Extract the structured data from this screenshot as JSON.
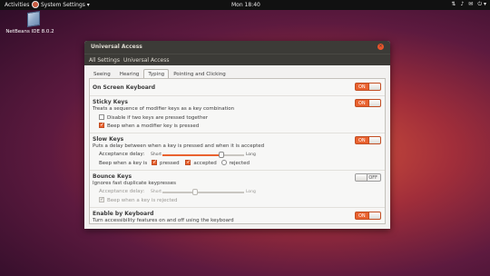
{
  "topbar": {
    "activities": "Activities",
    "app_menu": "System Settings ▾",
    "clock": "Mon 18:40",
    "status_icons": [
      "⇅",
      "♪",
      "✉",
      "⏻ ▾"
    ]
  },
  "desktop": {
    "icon_label": "NetBeans IDE 8.0.2"
  },
  "window": {
    "title": "Universal Access",
    "close": "×",
    "nav": {
      "all_settings": "All Settings",
      "current": "Universal Access"
    },
    "tabs": [
      "Seeing",
      "Hearing",
      "Typing",
      "Pointing and Clicking"
    ],
    "active_tab": "Typing",
    "sections": {
      "osk": {
        "title": "On Screen Keyboard",
        "toggle": "ON"
      },
      "sticky": {
        "title": "Sticky Keys",
        "desc": "Treats a sequence of modifier keys as a key combination",
        "toggle": "ON",
        "opt1": "Disable if two keys are pressed together",
        "opt2": "Beep when a modifier key is pressed"
      },
      "slow": {
        "title": "Slow Keys",
        "desc": "Puts a delay between when a key is pressed and when it is accepted",
        "toggle": "ON",
        "delay_label": "Acceptance delay:",
        "short": "Short",
        "long": "Long",
        "delay_level": 0.72,
        "beep_label": "Beep when a key is",
        "pressed": "pressed",
        "accepted": "accepted",
        "rejected": "rejected"
      },
      "bounce": {
        "title": "Bounce Keys",
        "desc": "Ignores fast duplicate keypresses",
        "toggle": "OFF",
        "delay_label": "Acceptance delay:",
        "short": "Short",
        "long": "Long",
        "delay_level": 0.4,
        "beep": "Beep when a key is rejected"
      },
      "enable_kb": {
        "title": "Enable by Keyboard",
        "desc": "Turn accessibility features on and off using the keyboard",
        "toggle": "ON"
      }
    }
  },
  "colors": {
    "accent": "#e9622f",
    "titlebar": "#3c3b37",
    "window_bg": "#f2f1f0"
  }
}
